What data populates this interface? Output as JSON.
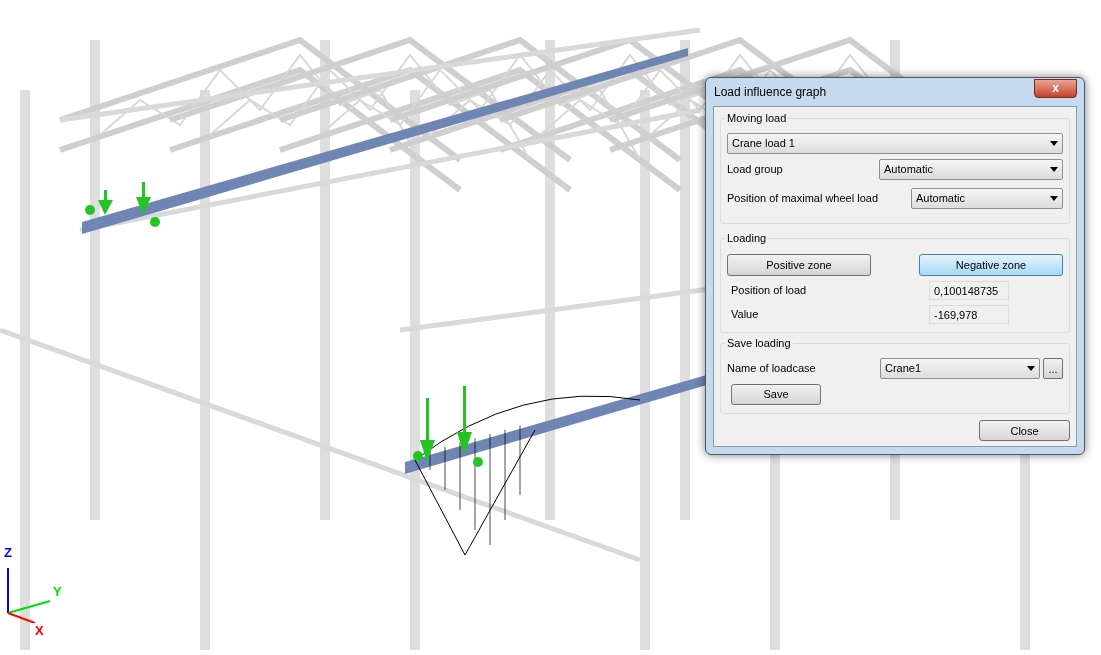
{
  "axes": [
    {
      "kind": "z",
      "label": "Z"
    },
    {
      "kind": "y",
      "label": "Y"
    },
    {
      "kind": "x",
      "label": "X"
    }
  ],
  "dialog": {
    "title": "Load influence graph",
    "close_glyph": "x",
    "moving_load": {
      "legend": "Moving load",
      "load": "Crane load 1",
      "load_group_label": "Load group",
      "load_group": "Automatic",
      "position_label": "Position of maximal wheel load",
      "position": "Automatic"
    },
    "loading": {
      "legend": "Loading",
      "zones": [
        {
          "label": "Positive zone",
          "selected": false
        },
        {
          "label": "Negative zone",
          "selected": true
        }
      ],
      "fields": [
        {
          "label": "Position of load",
          "value": "0,100148735"
        },
        {
          "label": "Value",
          "value": "-169,978"
        }
      ]
    },
    "save_loading": {
      "legend": "Save loading",
      "name_label": "Name of loadcase",
      "name": "Crane1",
      "browse": "...",
      "save": "Save"
    },
    "close": "Close"
  }
}
